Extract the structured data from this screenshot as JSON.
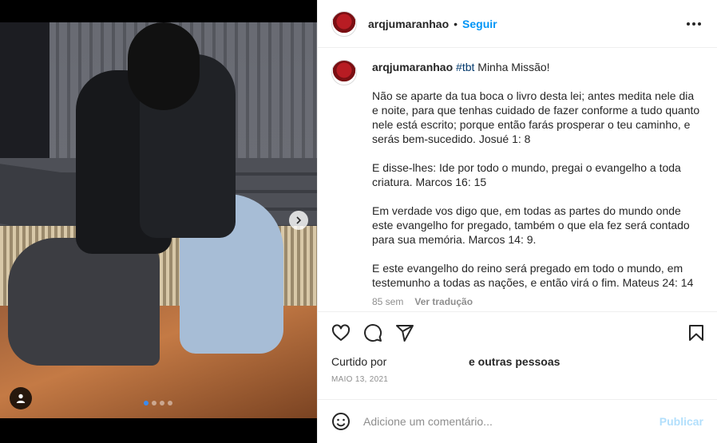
{
  "post": {
    "username": "arqjumaranhao",
    "separator": "•",
    "follow_label": "Seguir",
    "more_icon": "more-horizontal-icon",
    "carousel": {
      "slide_count": 4,
      "active_index": 0
    }
  },
  "caption": {
    "username": "arqjumaranhao",
    "hashtag": "#tbt",
    "title": " Minha Missão!",
    "paragraphs": [
      "Não se aparte da tua boca o livro desta lei; antes medita nele dia e noite, para que tenhas cuidado de fazer conforme a tudo quanto nele está escrito; porque então farás prosperar o teu caminho, e serás bem-sucedido. Josué 1: 8",
      "E disse-lhes: Ide por todo o mundo, pregai o evangelho a toda criatura. Marcos 16: 15",
      "Em verdade vos digo que, em todas as partes do mundo onde este evangelho for pregado, também o que ela fez será contado para sua memória. Marcos 14: 9.",
      "E este evangelho do reino será pregado em todo o mundo, em testemunho a todas as nações, e então virá o fim. Mateus 24: 14"
    ],
    "age": "85 sem",
    "translate_label": "Ver tradução"
  },
  "actions": {
    "like_icon": "heart-icon",
    "comment_icon": "comment-icon",
    "share_icon": "paper-plane-icon",
    "save_icon": "bookmark-icon"
  },
  "likes": {
    "prefix": "Curtido por",
    "suffix": "e outras pessoas"
  },
  "date": "MAIO 13, 2021",
  "comment": {
    "emoji_icon": "smiley-icon",
    "placeholder": "Adicione um comentário...",
    "publish_label": "Publicar"
  }
}
